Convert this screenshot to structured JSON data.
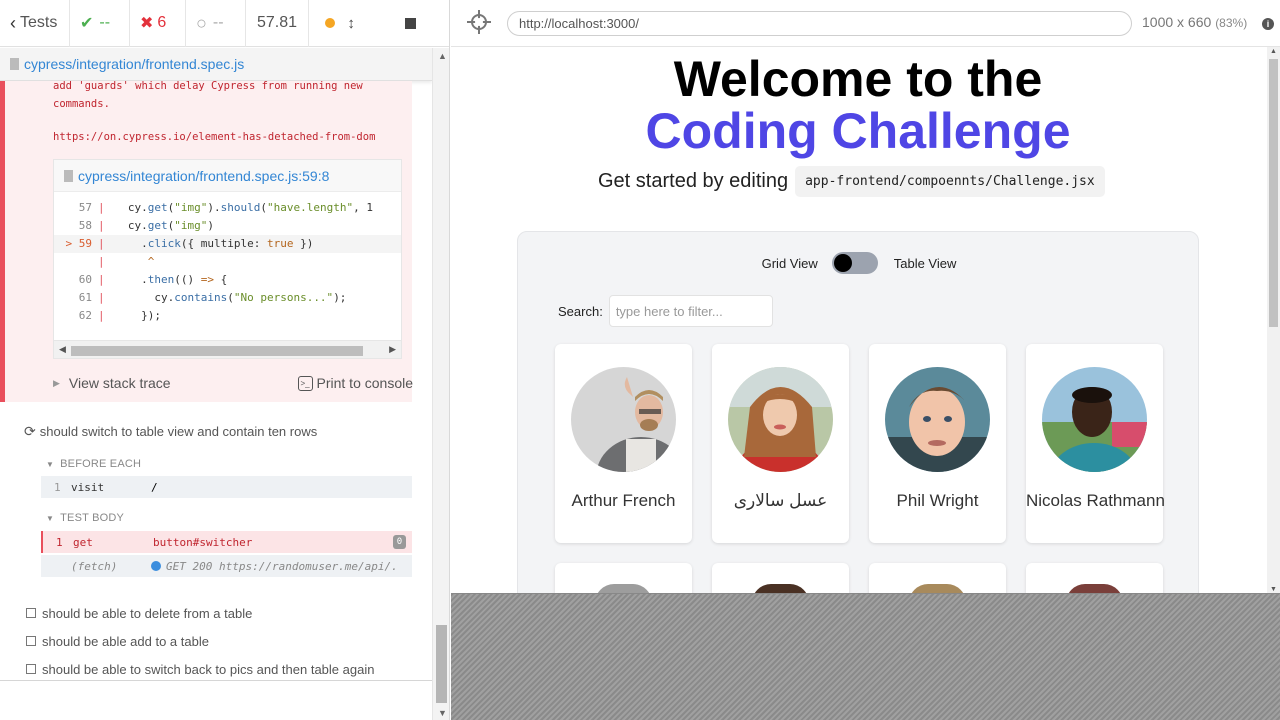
{
  "reporter": {
    "tests_label": "Tests",
    "passed": "--",
    "failed": "6",
    "pending": "--",
    "duration": "57.81",
    "spec_file": "cypress/integration/frontend.spec.js",
    "error": {
      "message_lines": [
        "add 'guards' which delay Cypress from running new",
        "commands."
      ],
      "link": "https://on.cypress.io/element-has-detached-from-dom",
      "code_frame_file": "cypress/integration/frontend.spec.js:59:8",
      "view_stack_trace": "View stack trace",
      "print_to_console": "Print to console"
    },
    "current_test": {
      "title": "should switch to table view and contain ten rows",
      "before_each_label": "BEFORE EACH",
      "test_body_label": "TEST BODY",
      "visit": {
        "num": "1",
        "name": "visit",
        "msg": "/"
      },
      "get": {
        "num": "1",
        "name": "get",
        "msg": "button#switcher",
        "badge": "0"
      },
      "fetch": {
        "name": "(fetch)",
        "msg": "GET 200 https://randomuser.me/api/..."
      }
    },
    "pending_tests": [
      "should be able to delete from a table",
      "should be able add to a table",
      "should be able to switch back to pics and then table again"
    ]
  },
  "aut": {
    "url": "http://localhost:3000/",
    "viewport": "1000 x 660",
    "scale": "(83%)",
    "title_line1": "Welcome to the",
    "title_line2": "Coding Challenge",
    "subtitle_text": "Get started by editing",
    "subtitle_code": "app-frontend/compoennts/Challenge.jsx",
    "grid_view_label": "Grid View",
    "table_view_label": "Table View",
    "search_label": "Search:",
    "search_placeholder": "type here to filter...",
    "persons": [
      {
        "name": "Arthur French"
      },
      {
        "name": "عسل سالاری"
      },
      {
        "name": "Phil Wright"
      },
      {
        "name": "Nicolas Rathmann"
      }
    ]
  },
  "colors": {
    "accent": "#4f46e5",
    "passed": "#4caf50",
    "failed": "#e3313b",
    "link": "#3386d4"
  }
}
